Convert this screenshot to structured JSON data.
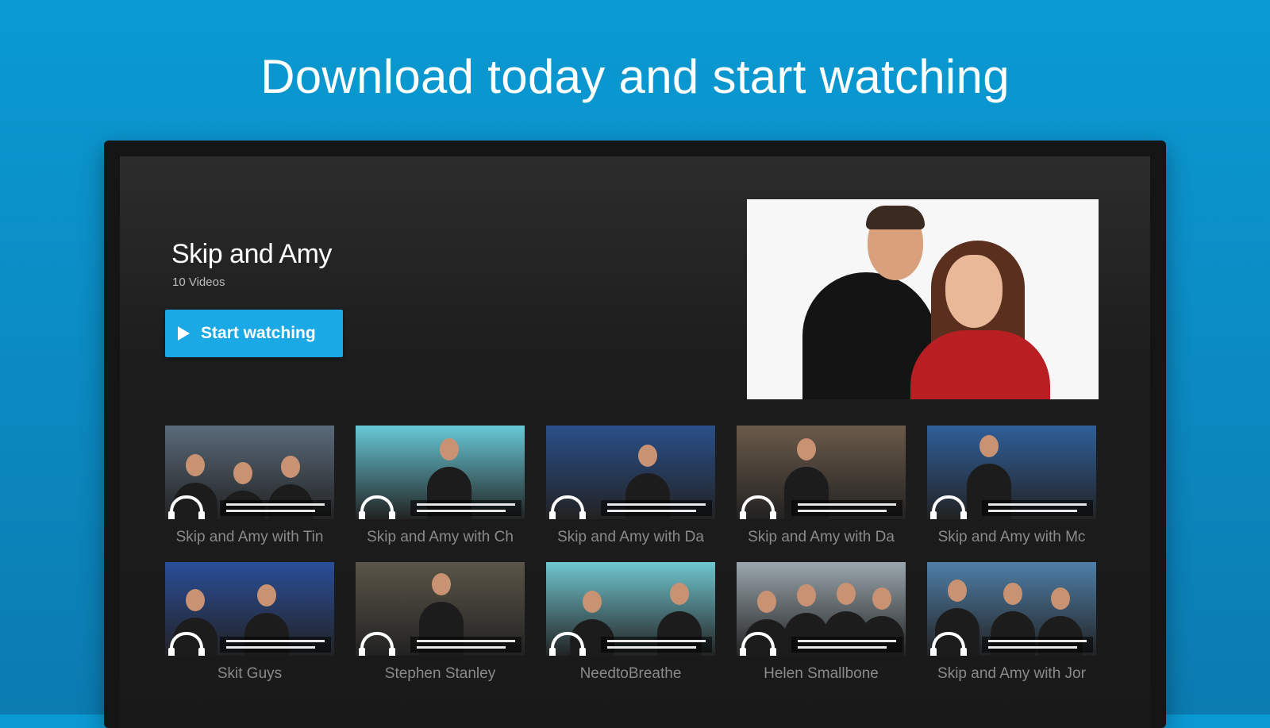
{
  "headline": "Download today and start watching",
  "show": {
    "title": "Skip and Amy",
    "count": "10 Videos",
    "cta_label": "Start watching"
  },
  "colors": {
    "background": "#0a9ad3",
    "accent": "#1ba9e6",
    "screen": "#1d1d1d"
  },
  "videos": [
    {
      "label": "Skip and Amy with Tin",
      "bg": "#5a6a7a"
    },
    {
      "label": "Skip and Amy with Ch",
      "bg": "#67c9d6"
    },
    {
      "label": "Skip and Amy with Da",
      "bg": "#2a4f8a"
    },
    {
      "label": "Skip and Amy with Da",
      "bg": "#6b5a4a"
    },
    {
      "label": "Skip and Amy with Mc",
      "bg": "#2f5f9a"
    },
    {
      "label": "Skit Guys",
      "bg": "#2a4e9a"
    },
    {
      "label": "Stephen Stanley",
      "bg": "#5a5548"
    },
    {
      "label": "NeedtoBreathe",
      "bg": "#6fc6cf"
    },
    {
      "label": "Helen Smallbone",
      "bg": "#9aa6ad"
    },
    {
      "label": "Skip and Amy with Jor",
      "bg": "#4f7fa8"
    }
  ]
}
